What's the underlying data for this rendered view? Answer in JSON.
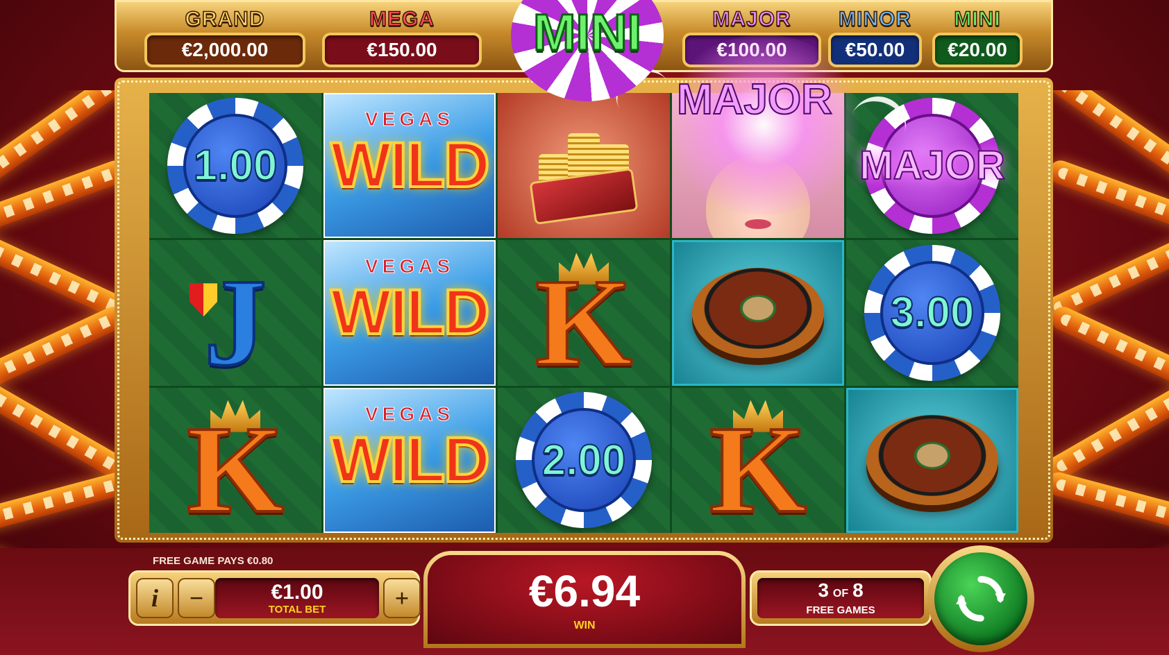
{
  "jackpots": [
    {
      "label": "GRAND",
      "value": "€2,000.00",
      "label_color": "#f7d36a",
      "box_color": "#6b2a0a"
    },
    {
      "label": "MEGA",
      "value": "€150.00",
      "label_color": "#ff4d5e",
      "box_color": "#7a0d1a"
    },
    {
      "label": "MAJOR",
      "value": "€100.00",
      "label_color": "#f08bff",
      "box_color": "#5c1478"
    },
    {
      "label": "MINOR",
      "value": "€50.00",
      "label_color": "#6ab8ff",
      "box_color": "#12307a"
    },
    {
      "label": "MINI",
      "value": "€20.00",
      "label_color": "#6df16e",
      "box_color": "#0f5a1c"
    }
  ],
  "feature_text": {
    "mini_top": "MINI",
    "major_center": "MAJOR",
    "major_chip": "MAJOR"
  },
  "reels": {
    "columns": [
      [
        {
          "symbol": "chip",
          "value": "1.00"
        },
        {
          "symbol": "J"
        },
        {
          "symbol": "K"
        }
      ],
      [
        {
          "symbol": "wild",
          "top": "VEGAS",
          "text": "WILD"
        },
        {
          "symbol": "wild",
          "top": "VEGAS",
          "text": "WILD"
        },
        {
          "symbol": "wild",
          "top": "VEGAS",
          "text": "WILD"
        }
      ],
      [
        {
          "symbol": "gold-coins"
        },
        {
          "symbol": "K"
        },
        {
          "symbol": "chip",
          "value": "2.00"
        }
      ],
      [
        {
          "symbol": "lady"
        },
        {
          "symbol": "roulette"
        },
        {
          "symbol": "K"
        }
      ],
      [
        {
          "symbol": "chip-major",
          "value": "MAJOR"
        },
        {
          "symbol": "chip",
          "value": "3.00"
        },
        {
          "symbol": "roulette"
        }
      ]
    ]
  },
  "bottom_bar": {
    "free_game_pays": "FREE GAME PAYS €0.80",
    "info_label": "i",
    "minus_label": "−",
    "plus_label": "+",
    "total_bet_value": "€1.00",
    "total_bet_label": "TOTAL BET",
    "win_value": "€6.94",
    "win_label": "WIN",
    "free_games_current": "3",
    "free_games_of": "OF",
    "free_games_total": "8",
    "free_games_label": "FREE GAMES"
  },
  "icons": {
    "spin": "spin-refresh-icon",
    "info": "info-icon"
  }
}
